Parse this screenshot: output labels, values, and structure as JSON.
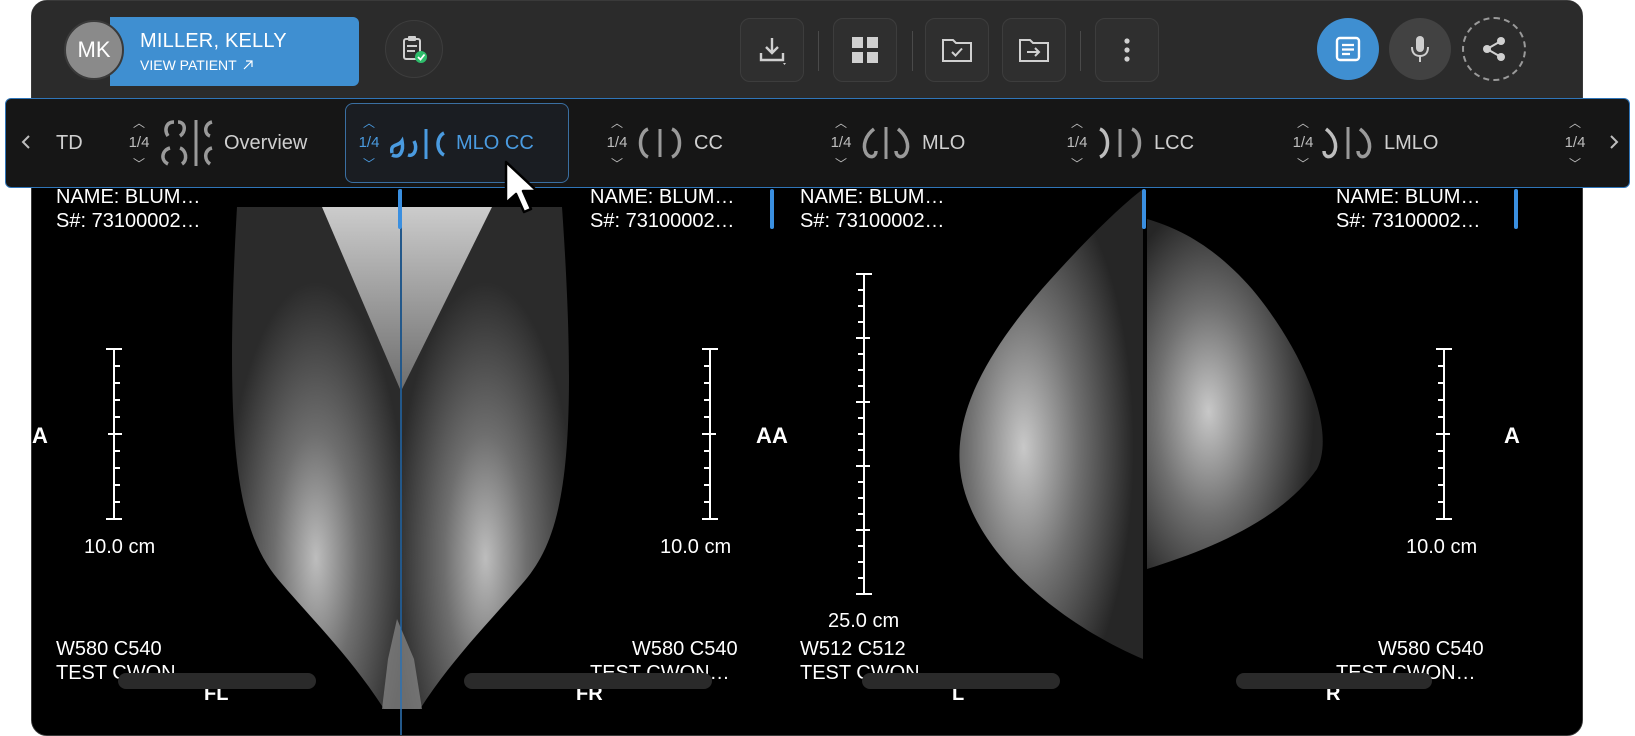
{
  "patient": {
    "initials": "MK",
    "name": "MILLER, KELLY",
    "link_label": "VIEW PATIENT"
  },
  "toolbar": {
    "buttons": [
      {
        "name": "clipboard-check-icon"
      },
      {
        "name": "download-icon"
      },
      {
        "name": "grid-layout-icon"
      },
      {
        "name": "folder-check-icon"
      },
      {
        "name": "folder-arrow-icon"
      },
      {
        "name": "more-vertical-icon"
      },
      {
        "name": "report-icon"
      },
      {
        "name": "microphone-icon"
      },
      {
        "name": "share-icon"
      }
    ],
    "accent_color": "#3f8fd1"
  },
  "viewbar": {
    "items": [
      {
        "label": "TD"
      },
      {
        "frac": "1/4",
        "label": "Overview"
      },
      {
        "frac": "1/4",
        "label": "MLO CC",
        "active": true
      },
      {
        "frac": "1/4",
        "label": "CC"
      },
      {
        "frac": "1/4",
        "label": "MLO"
      },
      {
        "frac": "1/4",
        "label": "LCC"
      },
      {
        "frac": "1/4",
        "label": "LMLO"
      },
      {
        "frac": "1/4"
      }
    ]
  },
  "panes": [
    {
      "name": "NAME: BLUM…",
      "snum": "S#: 73100002…",
      "scale": "10.0 cm",
      "wl": "W580 C540",
      "desc": "TEST CWON…",
      "view": "FL",
      "side": "A"
    },
    {
      "name": "NAME: BLUM…",
      "snum": "S#: 73100002…",
      "scale": "10.0 cm",
      "wl": "W580 C540",
      "desc": "TEST CWON…",
      "view": "FR",
      "side": "A"
    },
    {
      "name": "NAME: BLUM…",
      "snum": "S#: 73100002…",
      "scale": "25.0 cm",
      "wl": "W512 C512",
      "desc": "TEST CWON",
      "view": "L",
      "side": "A"
    },
    {
      "name": "NAME: BLUM…",
      "snum": "S#: 73100002…",
      "scale": "10.0 cm",
      "wl": "W580 C540",
      "desc": "TEST CWON…",
      "view": "R",
      "side": "A"
    }
  ]
}
